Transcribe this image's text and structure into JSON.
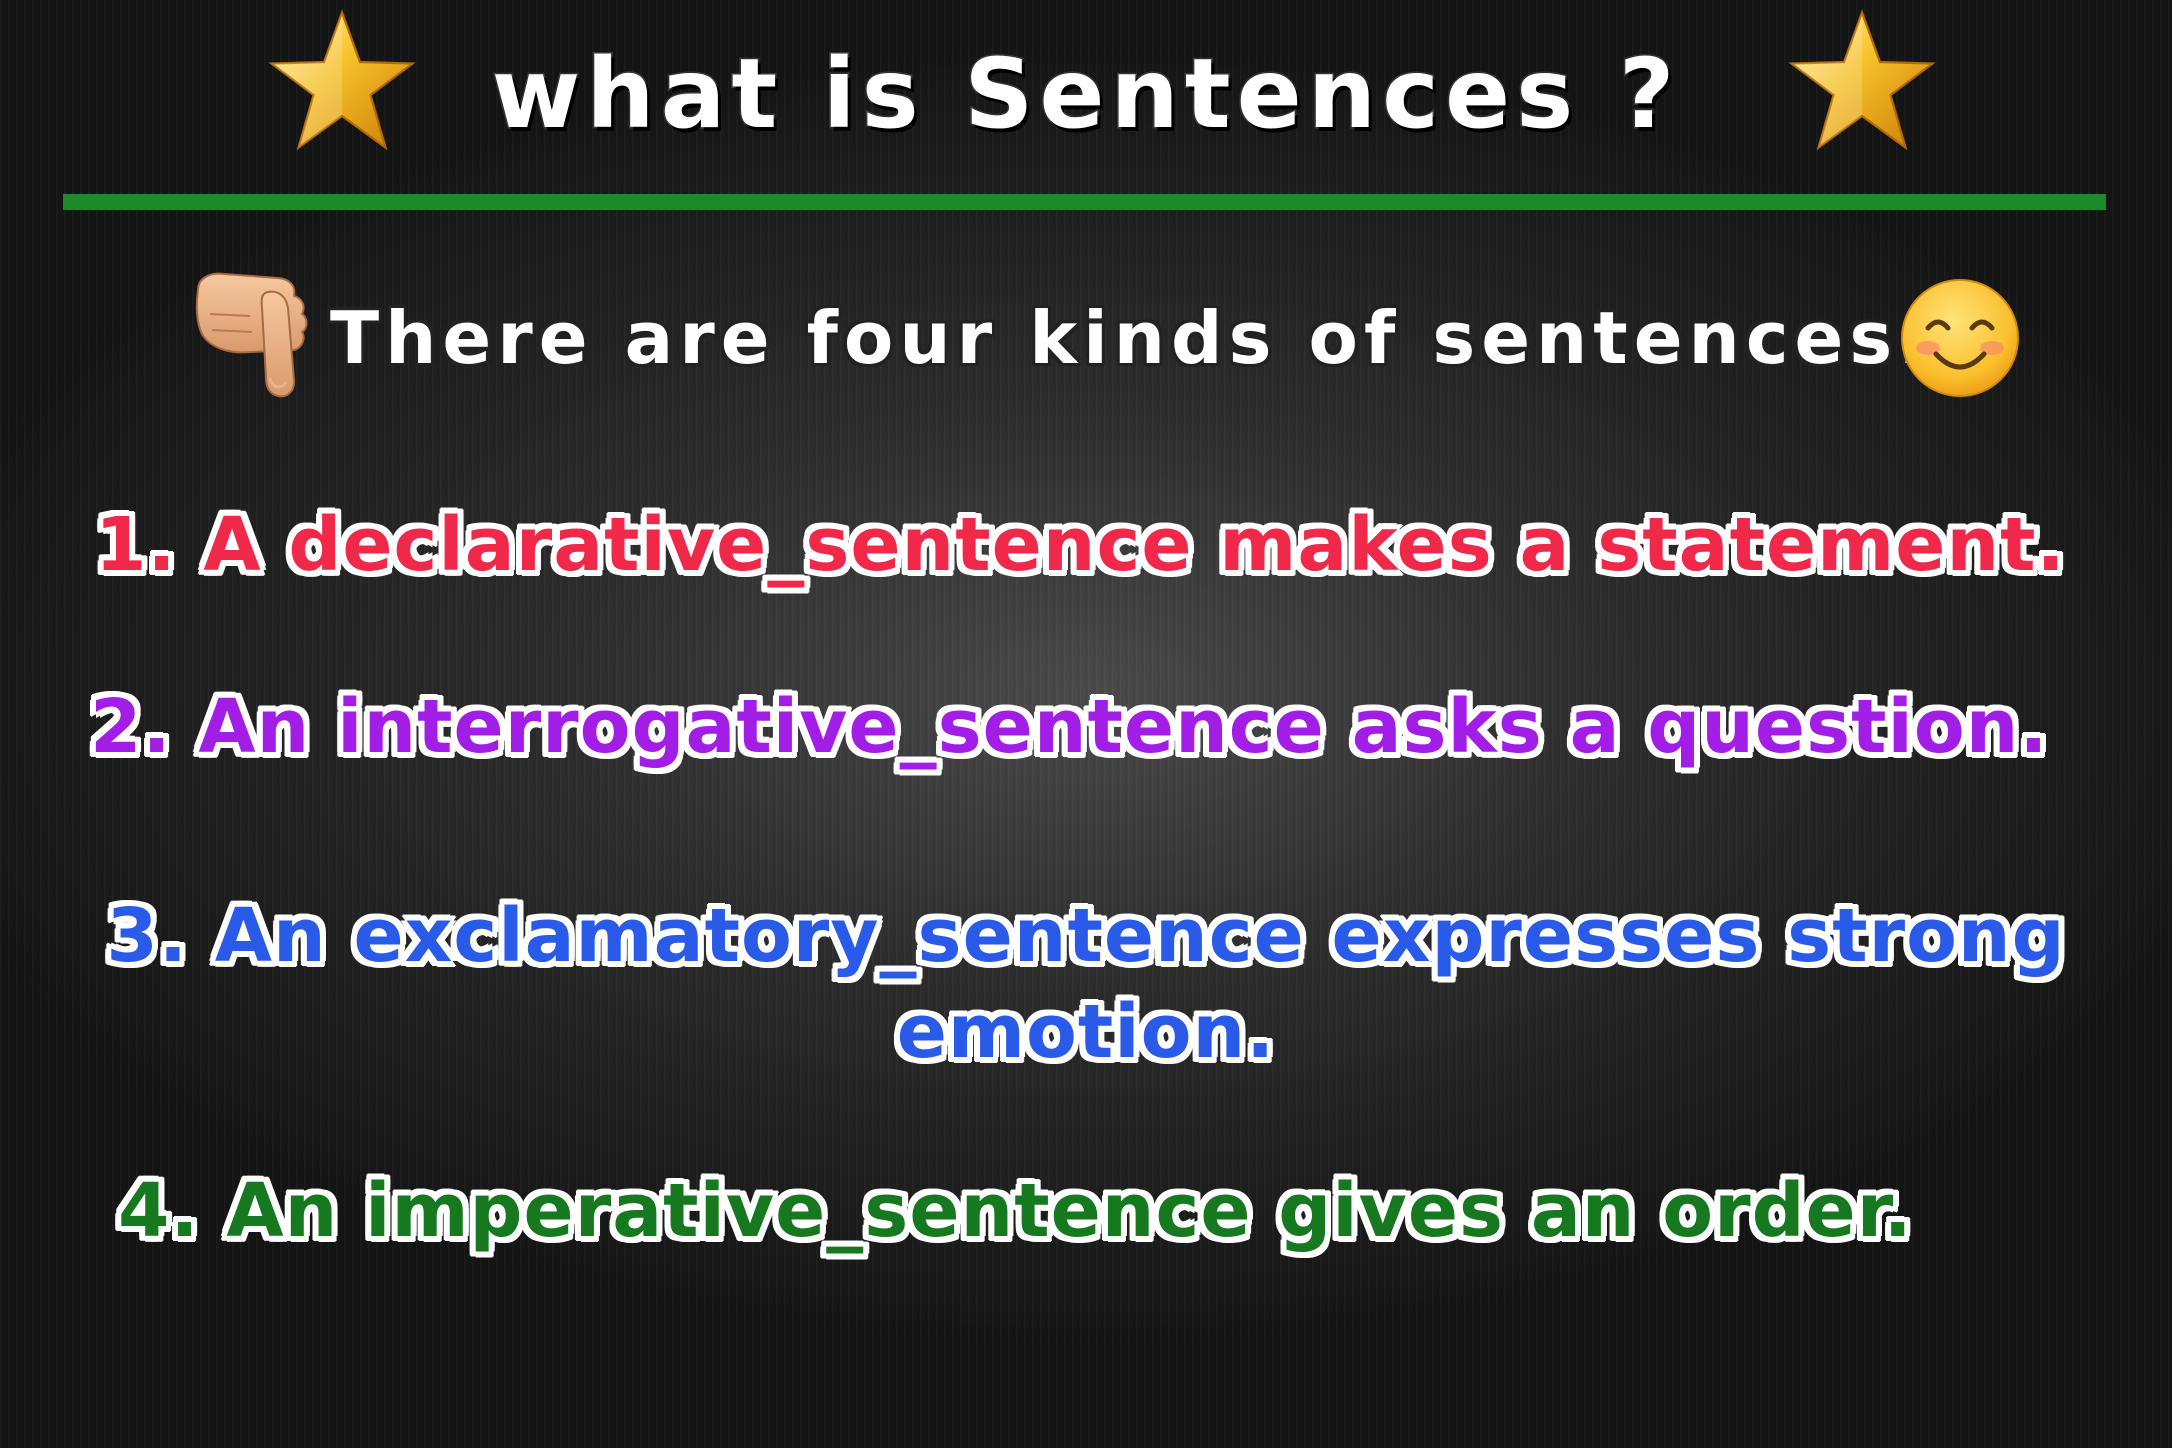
{
  "header": {
    "title": "what is Sentences ?",
    "left_icon": "star-icon",
    "right_icon": "star-icon"
  },
  "intro": {
    "text": "There are four kinds of sentences.",
    "leading_icon": "pointing-down-hand-icon",
    "trailing_icon": "smiling-face-icon"
  },
  "items": [
    {
      "text": "1. A declarative_sentence makes a statement.",
      "color": "#f0284a"
    },
    {
      "text": "2. An interrogative_sentence asks a question.",
      "color": "#a21ee6"
    },
    {
      "line1": "3. An exclamatory_sentence expresses strong",
      "line2": "emotion.",
      "color": "#2a5ae8"
    },
    {
      "text": "4. An imperative_sentence gives an order.",
      "color": "#16781f"
    }
  ],
  "colors": {
    "divider": "#1c8b2a",
    "background": "#1a1a1a",
    "title_text": "#ffffff"
  }
}
